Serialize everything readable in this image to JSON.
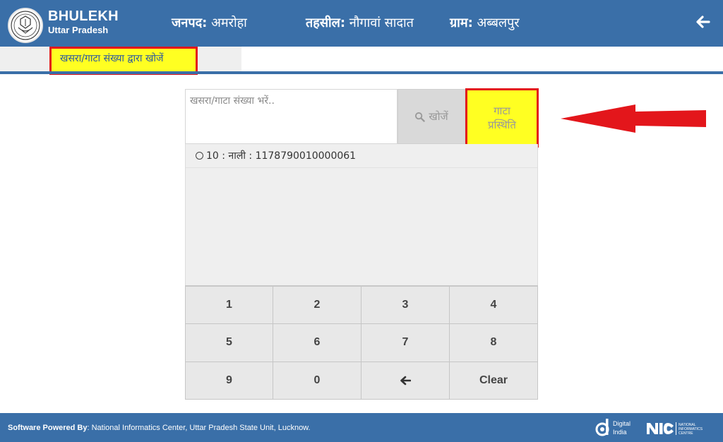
{
  "header": {
    "brand_title": "BHULEKH",
    "brand_subtitle": "Uttar Pradesh",
    "district_label": "जनपद:",
    "district_value": "अमरोहा",
    "tehsil_label": "तहसील:",
    "tehsil_value": "नौगावां सादात",
    "village_label": "ग्राम:",
    "village_value": "अब्बलपुर",
    "color": "#3a6fa8"
  },
  "tabs": [
    {
      "label": "खसरा/गाटा संख्या द्वारा खोजें",
      "active": true
    }
  ],
  "search": {
    "placeholder": "खसरा/गाटा संख्या भरें..",
    "value": "",
    "search_button_label": "खोजें",
    "status_button_line1": "गाटा",
    "status_button_line2": "प्रस्थिति"
  },
  "results": [
    {
      "text": "10 : नाली : 1178790010000061",
      "selected": false
    }
  ],
  "keypad": {
    "keys": [
      "1",
      "2",
      "3",
      "4",
      "5",
      "6",
      "7",
      "8",
      "9",
      "0",
      "backspace",
      "Clear"
    ]
  },
  "footer": {
    "powered_label": "Software Powered By",
    "powered_text": ": National Informatics Center, Uttar Pradesh State Unit, Lucknow.",
    "digital_india_line1": "Digital",
    "digital_india_line2": "India",
    "nic_line1": "NATIONAL",
    "nic_line2": "INFORMATICS",
    "nic_line3": "CENTRE"
  },
  "colors": {
    "accent": "#3a6fa8",
    "highlight": "#ffff22",
    "annotation": "#e3161b"
  }
}
